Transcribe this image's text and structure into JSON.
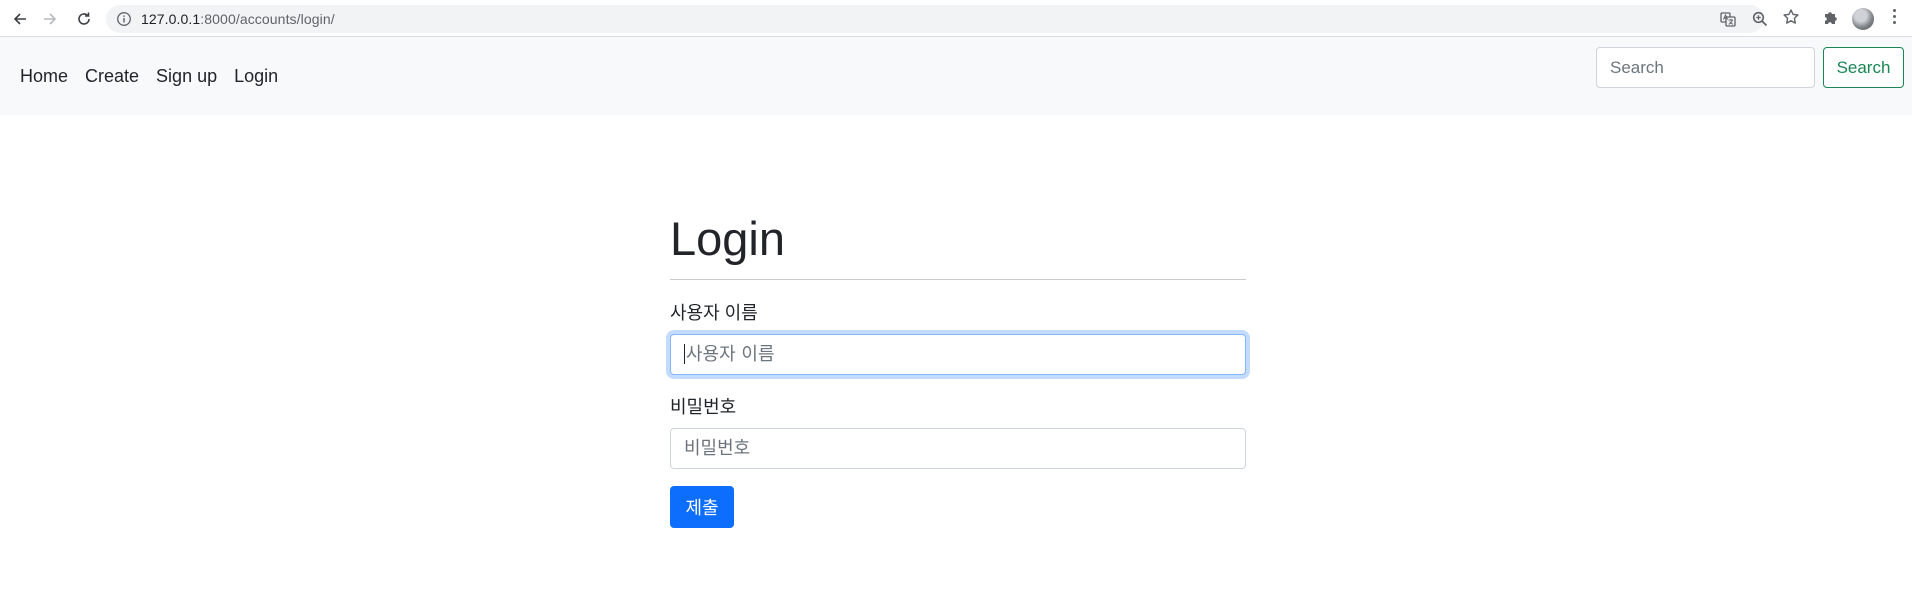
{
  "browser": {
    "url_host": "127.0.0.1",
    "url_rest": ":8000/accounts/login/",
    "icons": {
      "back": "back-arrow-icon",
      "forward": "forward-arrow-icon",
      "reload": "reload-icon",
      "site_info": "info-icon",
      "translate": "translate-icon",
      "zoom": "zoom-icon",
      "bookmark": "star-icon",
      "extensions": "puzzle-icon",
      "profile": "avatar",
      "menu": "kebab-menu-icon"
    }
  },
  "navbar": {
    "links": [
      "Home",
      "Create",
      "Sign up",
      "Login"
    ],
    "search_placeholder": "Search",
    "search_button": "Search",
    "search_button_color": "#198754",
    "background": "#f8f9fa"
  },
  "login": {
    "title": "Login",
    "username_label": "사용자 이름",
    "username_placeholder": "사용자 이름",
    "password_label": "비밀번호",
    "password_placeholder": "비밀번호",
    "submit_label": "제출",
    "submit_color": "#0d6efd"
  }
}
